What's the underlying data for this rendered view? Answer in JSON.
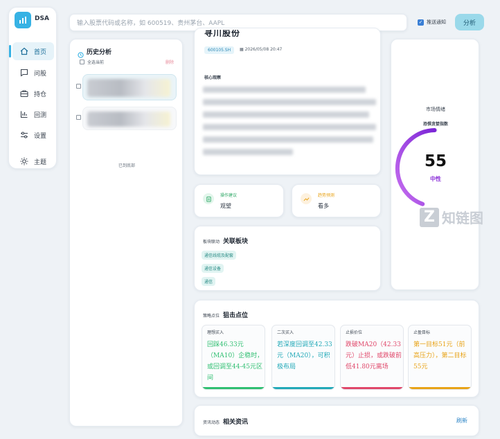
{
  "app": {
    "logo_text": "DSA"
  },
  "sidebar": {
    "items": [
      {
        "label": "首页",
        "icon": "home-icon",
        "active": true
      },
      {
        "label": "问股",
        "icon": "chat-icon",
        "active": false
      },
      {
        "label": "持仓",
        "icon": "briefcase-icon",
        "active": false
      },
      {
        "label": "回测",
        "icon": "chart-icon",
        "active": false
      },
      {
        "label": "设置",
        "icon": "settings-icon",
        "active": false
      }
    ],
    "theme_label": "主题"
  },
  "search": {
    "placeholder": "输入股票代码或名称，如 600519、贵州茅台、AAPL"
  },
  "notify": {
    "label": "推送通知",
    "checked": true
  },
  "analyze_button": "分析",
  "history": {
    "title": "历史分析",
    "select_all": "全选当前",
    "delete": "删除",
    "end_text": "已到底部"
  },
  "report": {
    "title": "寻川股份",
    "code": "600105.SH",
    "datetime": "2026/05/08 20:47",
    "summary_label": "核心观察"
  },
  "sentiment": {
    "title": "市场情绪",
    "subtitle": "恐惧贪婪指数",
    "value": 55,
    "label": "中性",
    "max": 100
  },
  "action": {
    "label": "操作建议",
    "value": "观望"
  },
  "trend": {
    "label": "趋势预测",
    "value": "看多"
  },
  "sector": {
    "section": "板块联动",
    "title": "关联板块",
    "tags": [
      "通信线缆及配套",
      "通信设备",
      "通信"
    ]
  },
  "sniper": {
    "section": "策略点位",
    "title": "狙击点位",
    "points": [
      {
        "label": "理想买入",
        "text": "回踩46.33元（MA10）企稳时，或回调至44-45元区间",
        "color": "#2fbf71"
      },
      {
        "label": "二次买入",
        "text": "若深度回调至42.33元（MA20），可积极布局",
        "color": "#22a9b8"
      },
      {
        "label": "止损价位",
        "text": "跌破MA20（42.33元）止损，或跌破前低41.80元离场",
        "color": "#e0476a"
      },
      {
        "label": "止盈目标",
        "text": "第一目标51元（前高压力），第二目标55元",
        "color": "#e8a317"
      }
    ]
  },
  "news": {
    "section": "资讯动态",
    "title": "相关资讯",
    "refresh": "刷新"
  },
  "watermark": {
    "text": "知链图"
  },
  "colors": {
    "accent": "#37b2e4",
    "gauge": "#8a2ed8"
  }
}
